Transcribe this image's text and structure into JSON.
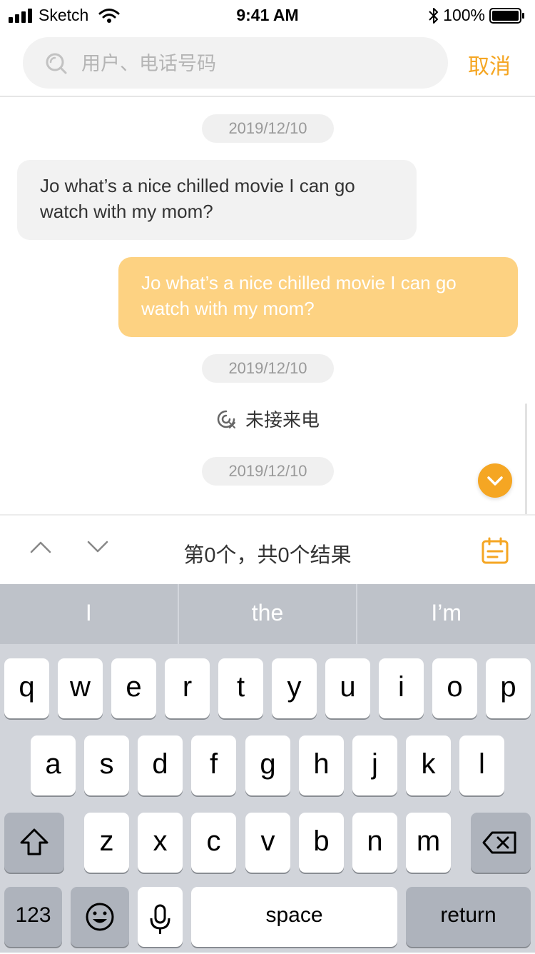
{
  "status_bar": {
    "carrier": "Sketch",
    "time": "9:41 AM",
    "battery": "100%"
  },
  "search": {
    "placeholder": "用户、电话号码",
    "value": "",
    "cancel_label": "取消"
  },
  "chat": {
    "date_1": "2019/12/10",
    "incoming_message": "Jo what’s a nice chilled movie I can go watch with my mom?",
    "outgoing_message": "Jo what’s a nice chilled movie I can go watch with my mom?",
    "date_2": "2019/12/10",
    "missed_call_label": "未接来电",
    "date_3": "2019/12/10"
  },
  "result_bar": {
    "result_text": "第0个，共0个结果"
  },
  "keyboard": {
    "suggestions": [
      "I",
      "the",
      "I’m"
    ],
    "row1": [
      "q",
      "w",
      "e",
      "r",
      "t",
      "y",
      "u",
      "i",
      "o",
      "p"
    ],
    "row2": [
      "a",
      "s",
      "d",
      "f",
      "g",
      "h",
      "j",
      "k",
      "l"
    ],
    "row3": [
      "z",
      "x",
      "c",
      "v",
      "b",
      "n",
      "m"
    ],
    "numbers_label": "123",
    "space_label": "space",
    "return_label": "return"
  },
  "colors": {
    "accent": "#f5a623",
    "outgoing_bubble": "#fdd282",
    "incoming_bubble": "#f2f2f2",
    "keyboard_bg": "#d1d4da"
  }
}
